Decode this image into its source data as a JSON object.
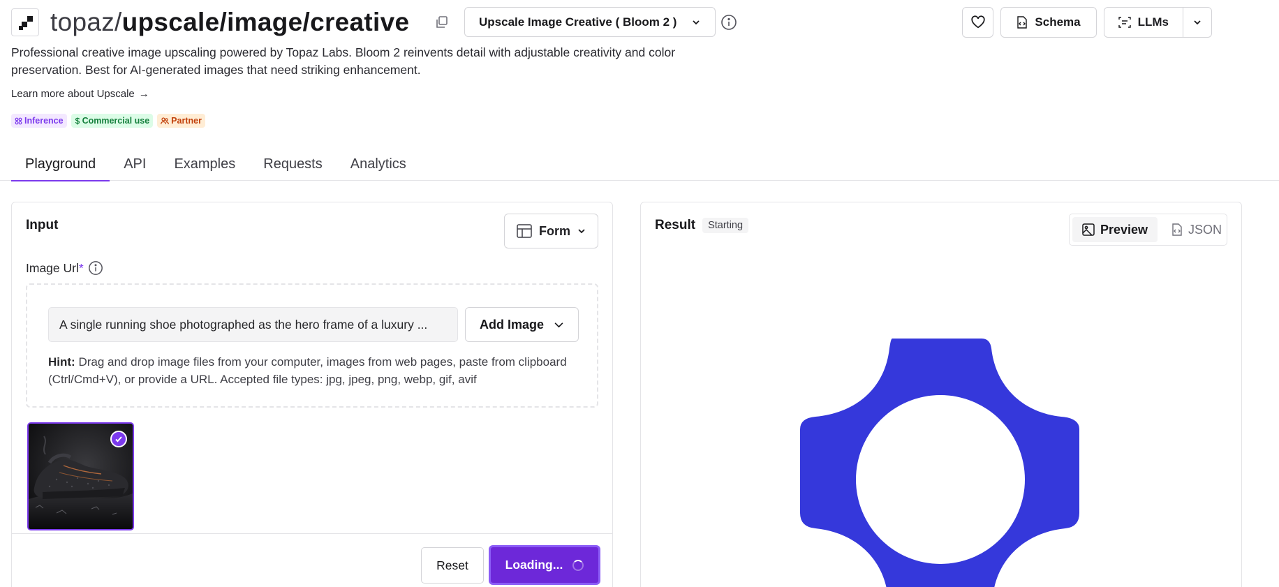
{
  "header": {
    "owner": "topaz/",
    "model_name": "upscale/image/creative",
    "model_select": "Upscale Image Creative ( Bloom 2 )",
    "actions": {
      "schema": "Schema",
      "llms": "LLMs"
    }
  },
  "description": "Professional creative image upscaling powered by Topaz Labs. Bloom 2 reinvents detail with adjustable creativity and color preservation. Best for AI-generated images that need striking enhancement.",
  "learn_more": "Learn more about Upscale",
  "learn_more_arrow": "→",
  "badges": {
    "inference": "Inference",
    "commercial": "Commercial use",
    "partner": "Partner"
  },
  "tabs": [
    {
      "label": "Playground",
      "active": true
    },
    {
      "label": "API"
    },
    {
      "label": "Examples"
    },
    {
      "label": "Requests"
    },
    {
      "label": "Analytics"
    }
  ],
  "input": {
    "title": "Input",
    "form_button": "Form",
    "image_url_label": "Image Url",
    "required_mark": "*",
    "image_url_value": "A single running shoe photographed as the hero frame of a luxury ...",
    "add_image": "Add Image",
    "hint_label": "Hint:",
    "hint_text": " Drag and drop image files from your computer, images from web pages, paste from clipboard (Ctrl/Cmd+V), or provide a URL. Accepted file types: jpg, jpeg, png, webp, gif, avif",
    "reset": "Reset",
    "run": "Loading..."
  },
  "result": {
    "title": "Result",
    "status": "Starting",
    "preview": "Preview",
    "json": "JSON"
  },
  "colors": {
    "accent": "#7c3aed",
    "loader": "#3538db"
  }
}
